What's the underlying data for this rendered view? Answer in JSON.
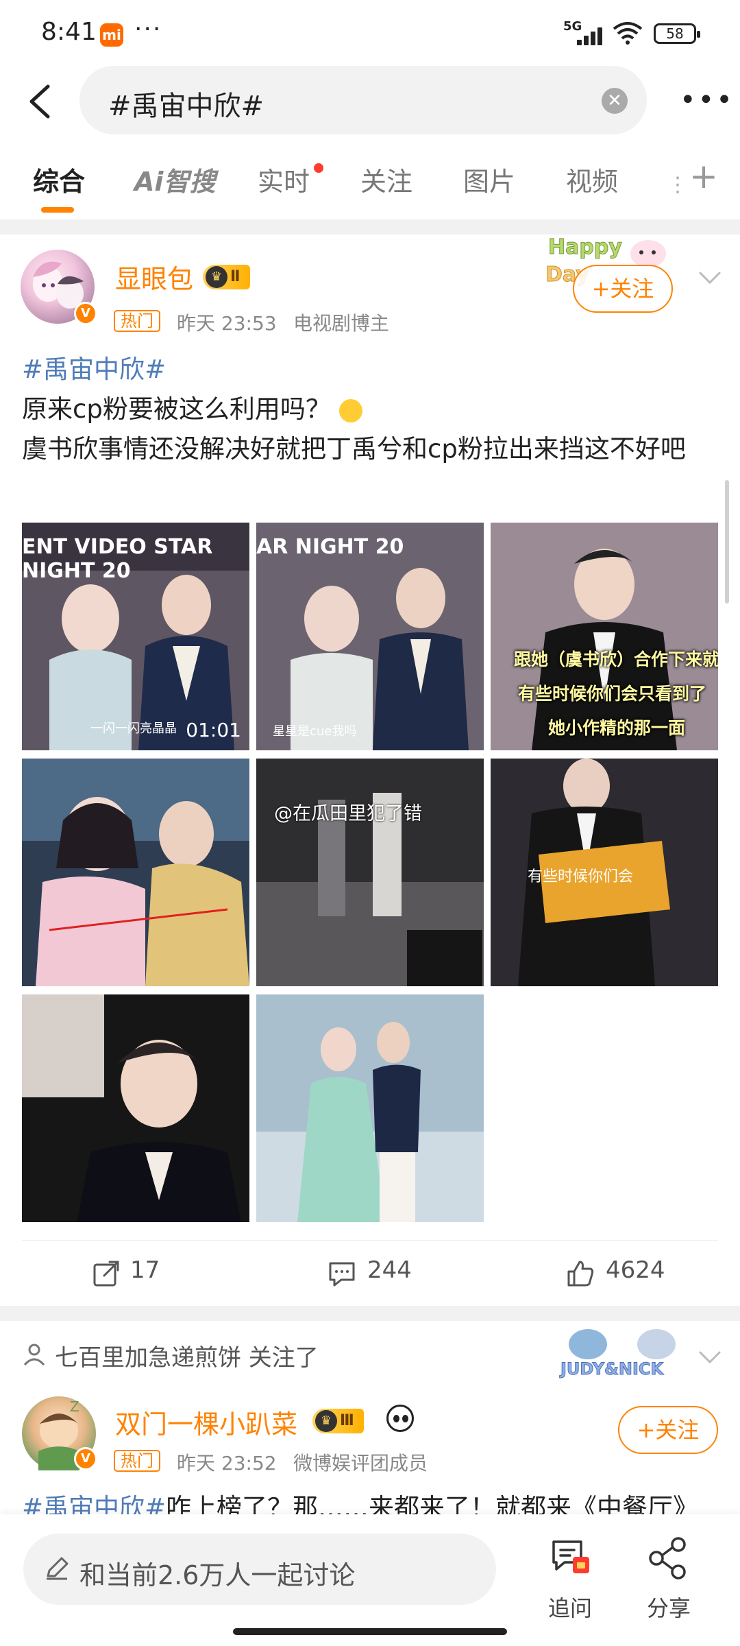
{
  "status_bar": {
    "time": "8:41",
    "app_badge": "mi",
    "dots": "···",
    "network": "5G",
    "battery": "58"
  },
  "search": {
    "query": "#禹宙中欣#"
  },
  "tabs": [
    {
      "label": "综合"
    },
    {
      "label_ai": "Ai",
      "label": "智搜"
    },
    {
      "label": "实时"
    },
    {
      "label": "关注"
    },
    {
      "label": "图片"
    },
    {
      "label": "视频"
    }
  ],
  "post1": {
    "username": "显眼包",
    "level": "Ⅱ",
    "hot_tag": "热门",
    "time": "昨天 23:53",
    "role": "电视剧博主",
    "follow_label": "+关注",
    "hashtag": "#禹宙中欣#",
    "line1": "原来cp粉要被这么利用吗？",
    "line2": "虞书欣事情还没解决好就把丁禹兮和cp粉拉出来挡这不好吧",
    "images": [
      {
        "overlay_top": "ENT VIDEO STAR NIGHT 20",
        "overlay_bottom": "一闪一闪亮晶晶",
        "duration": "01:01"
      },
      {
        "overlay_top": "AR NIGHT 20",
        "overlay_bottom": "星星是cue我吗"
      },
      {
        "caption1": "跟她（虞书欣）合作下来就是",
        "caption2": "有些时候你们会只看到了",
        "caption3": "她小作精的那一面"
      },
      {
        "overlay_top": ""
      },
      {
        "watermark": "@在瓜田里犯了错"
      },
      {
        "caption": "有些时候你们会"
      },
      {
        "overlay_top": ""
      },
      {
        "overlay_top": ""
      }
    ],
    "reposts": "17",
    "comments": "244",
    "likes": "4624"
  },
  "post2": {
    "follow_note": "七百里加急递煎饼 关注了",
    "username": "双门一棵小趴菜",
    "level": "Ⅲ",
    "hot_tag": "热门",
    "time": "昨天 23:52",
    "role": "微博娱评团成员",
    "follow_label": "+关注",
    "hashtag": "#禹宙中欣#",
    "text": "咋上榜了？那……来都来了！就都来《中餐厅》"
  },
  "bottom_bar": {
    "comment_placeholder": "和当前2.6万人一起讨论",
    "ask_label": "追问",
    "share_label": "分享"
  },
  "colors": {
    "accent": "#ff8200",
    "hashtag": "#4f7cb8",
    "badge_red": "#ff3b30"
  }
}
